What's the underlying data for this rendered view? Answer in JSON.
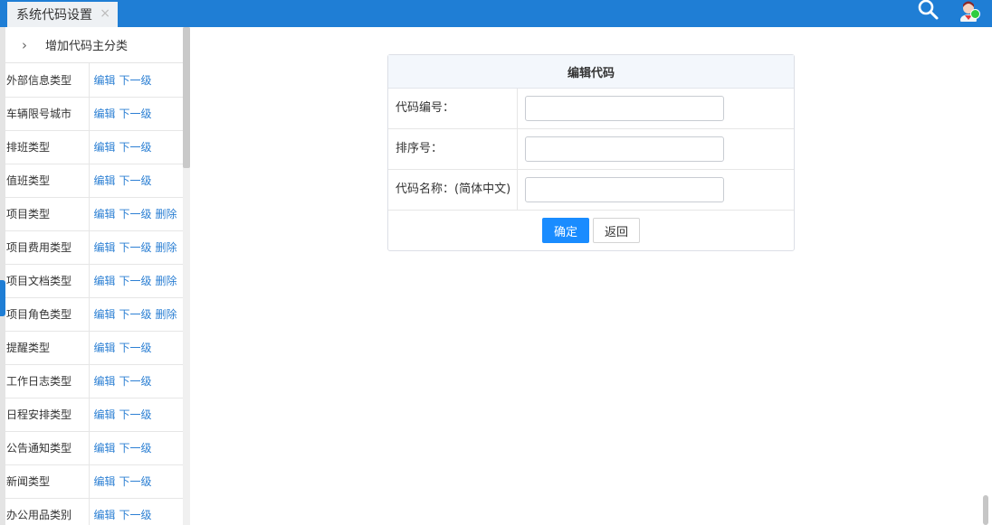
{
  "header": {
    "tab_title": "系统代码设置",
    "tab_close": "×",
    "icons": [
      "search-icon",
      "user-avatar-icon"
    ],
    "accent_color": "#1f7ed5"
  },
  "left_panel": {
    "add_root_label": "增加代码主分类",
    "rows": [
      {
        "name": "外部信息类型",
        "ops": [
          "编辑",
          "下一级"
        ]
      },
      {
        "name": "车辆限号城市",
        "ops": [
          "编辑",
          "下一级"
        ]
      },
      {
        "name": "排班类型",
        "ops": [
          "编辑",
          "下一级"
        ]
      },
      {
        "name": "值班类型",
        "ops": [
          "编辑",
          "下一级"
        ]
      },
      {
        "name": "项目类型",
        "ops": [
          "编辑",
          "下一级",
          "删除"
        ]
      },
      {
        "name": "项目费用类型",
        "ops": [
          "编辑",
          "下一级",
          "删除"
        ]
      },
      {
        "name": "项目文档类型",
        "ops": [
          "编辑",
          "下一级",
          "删除"
        ]
      },
      {
        "name": "项目角色类型",
        "ops": [
          "编辑",
          "下一级",
          "删除"
        ]
      },
      {
        "name": "提醒类型",
        "ops": [
          "编辑",
          "下一级"
        ]
      },
      {
        "name": "工作日志类型",
        "ops": [
          "编辑",
          "下一级"
        ]
      },
      {
        "name": "日程安排类型",
        "ops": [
          "编辑",
          "下一级"
        ]
      },
      {
        "name": "公告通知类型",
        "ops": [
          "编辑",
          "下一级"
        ]
      },
      {
        "name": "新闻类型",
        "ops": [
          "编辑",
          "下一级"
        ]
      },
      {
        "name": "办公用品类别",
        "ops": [
          "编辑",
          "下一级"
        ]
      }
    ]
  },
  "form": {
    "title": "编辑代码",
    "fields": [
      {
        "label": "代码编号：",
        "value": ""
      },
      {
        "label": "排序号：",
        "value": ""
      },
      {
        "label": "代码名称：(简体中文)",
        "value": ""
      }
    ],
    "confirm_label": "确定",
    "back_label": "返回"
  }
}
